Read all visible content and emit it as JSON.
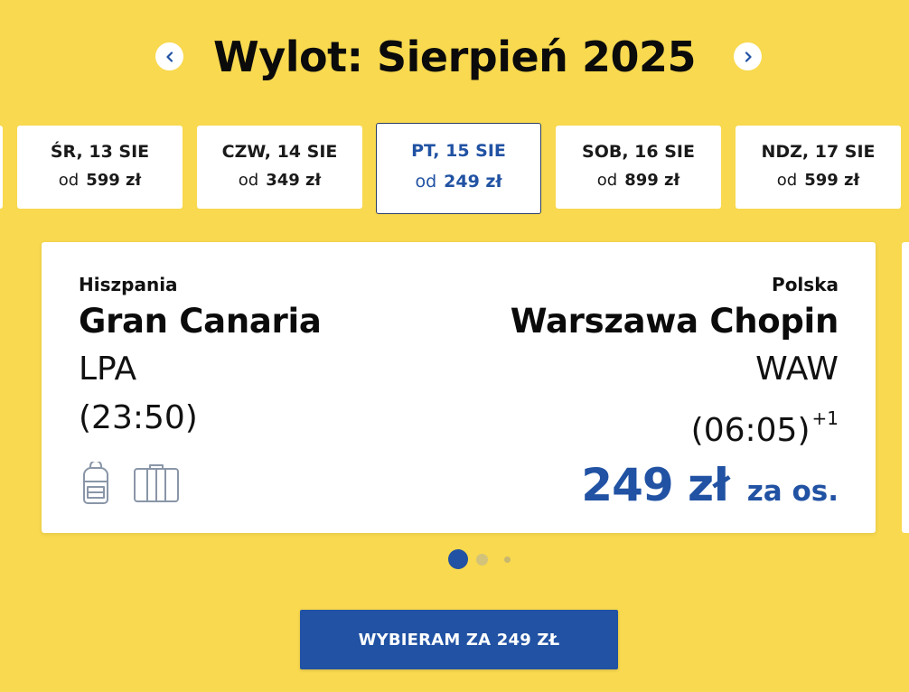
{
  "header": {
    "title": "Wylot: Sierpień 2025",
    "prev_icon": "chevron-left-icon",
    "next_icon": "chevron-right-icon"
  },
  "date_strip": {
    "od_label": "od",
    "dates": [
      {
        "label": "ŚR, 13 SIE",
        "price": "599 zł",
        "selected": false
      },
      {
        "label": "CZW, 14 SIE",
        "price": "349 zł",
        "selected": false
      },
      {
        "label": "PT, 15 SIE",
        "price": "249 zł",
        "selected": true
      },
      {
        "label": "SOB, 16 SIE",
        "price": "899 zł",
        "selected": false
      },
      {
        "label": "NDZ, 17 SIE",
        "price": "599 zł",
        "selected": false
      }
    ]
  },
  "flight": {
    "origin": {
      "country": "Hiszpania",
      "airport": "Gran Canaria",
      "code": "LPA",
      "time": "(23:50)"
    },
    "destination": {
      "country": "Polska",
      "airport": "Warszawa Chopin",
      "code": "WAW",
      "time": "(06:05)",
      "day_offset": "+1"
    },
    "price": "249 zł",
    "price_suffix": "za os.",
    "icons": [
      "backpack-icon",
      "suitcase-icon"
    ]
  },
  "pagination": {
    "total": 3,
    "active": 1
  },
  "cta": {
    "label": "WYBIERAM ZA 249 ZŁ"
  },
  "colors": {
    "background": "#f8d94f",
    "accent_blue": "#2152a3",
    "card": "#ffffff",
    "text": "#111111",
    "icon_gray": "#8a96a8"
  }
}
